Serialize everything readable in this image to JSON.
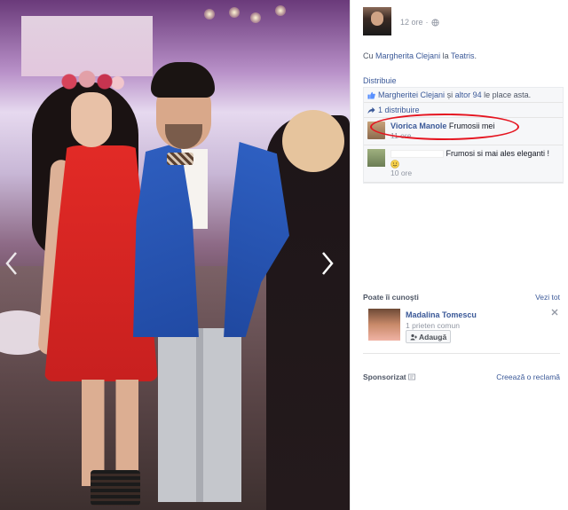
{
  "photo": {
    "alt_description": ""
  },
  "post": {
    "time": "12 ore",
    "with_prefix": "Cu",
    "with_person": "Margherita Clejani",
    "at_word": "la",
    "place": "Teatris",
    "share_label": "Distribuie"
  },
  "ufi": {
    "likes_person": "Margheritei Clejani",
    "likes_and": "și",
    "likes_others": "altor 94",
    "likes_suffix": "le place asta.",
    "shares": "1 distribuire"
  },
  "comments": [
    {
      "author": "Viorica Manole",
      "text": "Frumosii mei",
      "time": "11 ore"
    },
    {
      "author": "",
      "text": "Frumosi si mai ales eleganti !",
      "time": "10 ore"
    }
  ],
  "pymk": {
    "title": "Poate îi cunoşti",
    "see_all": "Vezi tot",
    "name": "Madalina Tomescu",
    "mutual": "1 prieten comun",
    "add_label": "Adaugă"
  },
  "sponsored": {
    "title": "Sponsorizat",
    "create_ad": "Creează o reclamă"
  },
  "colors": {
    "link": "#3b5998",
    "highlight": "#e5141f"
  },
  "icons": [
    "globe-icon",
    "like-icon",
    "share-icon",
    "smile-icon",
    "add-friend-icon",
    "close-icon",
    "chevron-left-icon",
    "chevron-right-icon",
    "ad-icon"
  ]
}
